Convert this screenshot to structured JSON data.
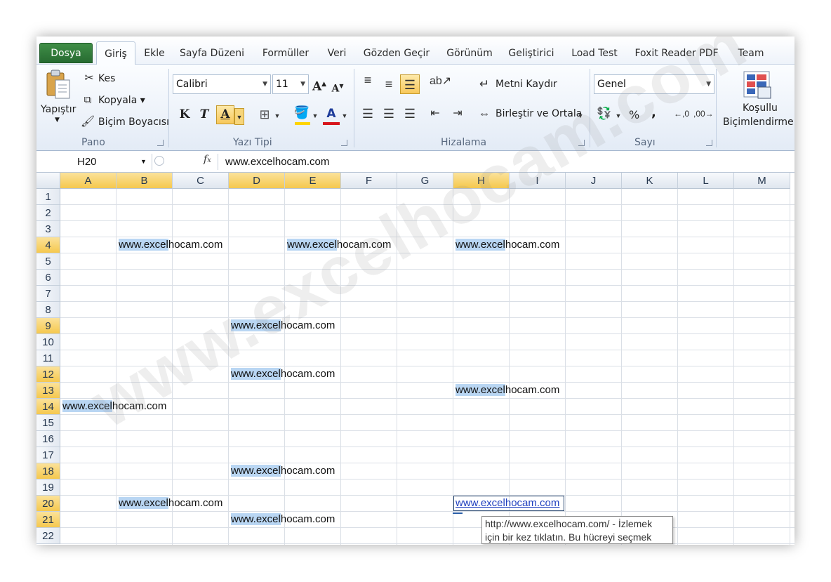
{
  "ribbon_tabs": [
    "Dosya",
    "Giriş",
    "Ekle",
    "Sayfa Düzeni",
    "Formüller",
    "Veri",
    "Gözden Geçir",
    "Görünüm",
    "Geliştirici",
    "Load Test",
    "Foxit Reader PDF",
    "Team"
  ],
  "clipboard": {
    "paste": "Yapıştır",
    "cut": "Kes",
    "copy": "Kopyala ▾",
    "format_painter": "Biçim Boyacısı",
    "group": "Pano"
  },
  "font": {
    "name": "Calibri",
    "size": "11",
    "bold": "K",
    "italic": "T",
    "underline": "A",
    "group": "Yazı Tipi",
    "fill_color": "#ffd400",
    "font_color": "#d7151c"
  },
  "alignment": {
    "wrap_text": "Metni Kaydır",
    "merge_center": "Birleştir ve Ortala",
    "group": "Hizalama"
  },
  "number": {
    "format": "Genel",
    "percent": "%",
    "comma": ",",
    "group": "Sayı"
  },
  "styles": {
    "conditional_line1": "Koşullu",
    "conditional_line2": "Biçimlendirme"
  },
  "formula_bar": {
    "name_box": "H20",
    "fx": "fx",
    "content": "www.excelhocam.com"
  },
  "columns": [
    "A",
    "B",
    "C",
    "D",
    "E",
    "F",
    "G",
    "H",
    "I",
    "J",
    "K",
    "L",
    "M"
  ],
  "rows": [
    "1",
    "2",
    "3",
    "4",
    "5",
    "6",
    "7",
    "8",
    "9",
    "10",
    "11",
    "12",
    "13",
    "14",
    "15",
    "16",
    "17",
    "18",
    "19",
    "20",
    "21",
    "22"
  ],
  "cells": [
    {
      "ref": "B4",
      "a": "www.excel",
      "b": "hocam.com"
    },
    {
      "ref": "E4",
      "a": "www.excel",
      "b": "hocam.com"
    },
    {
      "ref": "H4",
      "a": "www.excel",
      "b": "hocam.com"
    },
    {
      "ref": "D9",
      "a": "www.excel",
      "b": "hocam.com"
    },
    {
      "ref": "D12",
      "a": "www.excel",
      "b": "hocam.com"
    },
    {
      "ref": "H13",
      "a": "www.excel",
      "b": "hocam.com"
    },
    {
      "ref": "A14",
      "a": "www.excel",
      "b": "hocam.com"
    },
    {
      "ref": "D18",
      "a": "www.excel",
      "b": "hocam.com"
    },
    {
      "ref": "B20",
      "a": "www.excel",
      "b": "hocam.com"
    },
    {
      "ref": "H20",
      "a": "www.excel",
      "b": "hocam.com"
    },
    {
      "ref": "D21",
      "a": "www.excel",
      "b": "hocam.com"
    }
  ],
  "tooltip": {
    "line1": "http://www.excelhocam.com/ - İzlemek",
    "line2": "için bir kez tıklatın. Bu hücreyi seçmek"
  },
  "watermark": "www.excelhocam.com",
  "colors": {
    "file_tab": "#2f7d3a",
    "selected_header": "#f5c84e",
    "cell_highlight": "#b9d6f3",
    "hyperlink": "#1f3fbf"
  }
}
